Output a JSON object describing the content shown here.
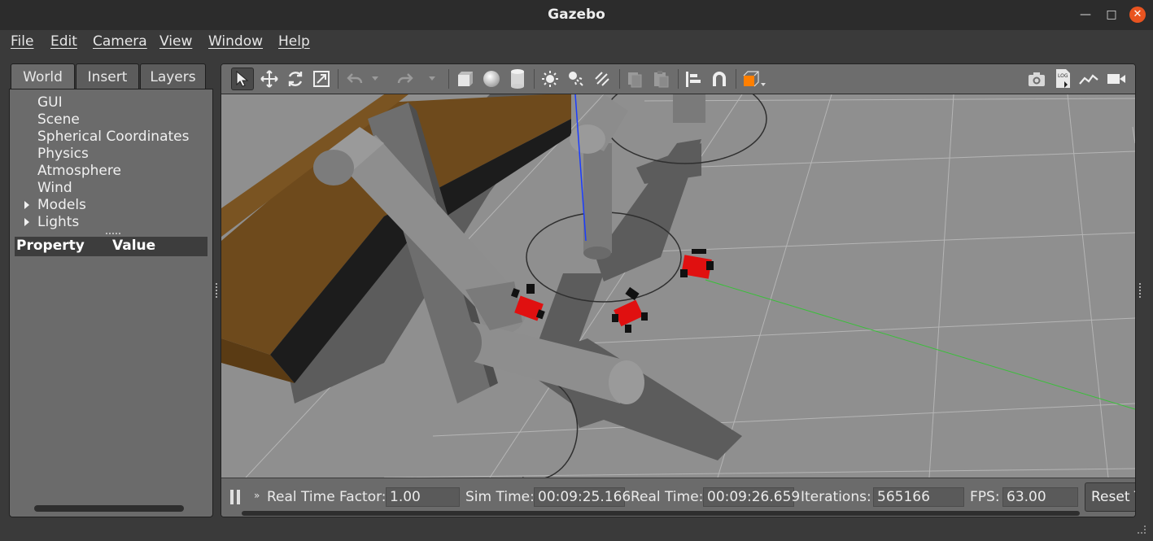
{
  "window": {
    "title": "Gazebo"
  },
  "menu": [
    "File",
    "Edit",
    "Camera",
    "View",
    "Window",
    "Help"
  ],
  "left_panel": {
    "tabs": [
      "World",
      "Insert",
      "Layers"
    ],
    "tree": [
      "GUI",
      "Scene",
      "Spherical Coordinates",
      "Physics",
      "Atmosphere",
      "Wind",
      "Models",
      "Lights"
    ],
    "property_header": {
      "property": "Property",
      "value": "Value"
    }
  },
  "toolbar": {
    "left_icons": [
      "select-arrow-icon",
      "translate-icon",
      "rotate-icon",
      "scale-icon",
      "undo-icon",
      "redo-icon",
      "box-icon",
      "sphere-icon",
      "cylinder-icon",
      "point-light-icon",
      "spot-light-icon",
      "directional-light-icon",
      "copy-icon",
      "paste-icon",
      "align-icon",
      "snap-icon",
      "view-angle-icon"
    ],
    "right_icons": [
      "screenshot-icon",
      "log-icon",
      "plot-icon",
      "record-video-icon"
    ],
    "log_label": "LOG"
  },
  "status": {
    "rtf_label": "Real Time Factor:",
    "rtf_value": "1.00",
    "sim_time_label": "Sim Time:",
    "sim_time_value": "00:09:25.166",
    "real_time_label": "Real Time:",
    "real_time_value": "00:09:26.659",
    "iterations_label": "Iterations:",
    "iterations_value": "565166",
    "fps_label": "FPS:",
    "fps_value": "63.00",
    "reset_label": "Reset Time",
    "step_label": "»"
  },
  "colors": {
    "accent_close": "#e95420",
    "robot_red": "#e01010",
    "ground": "#8c8c8c",
    "conveyor_brown": "#6e4a1c"
  }
}
